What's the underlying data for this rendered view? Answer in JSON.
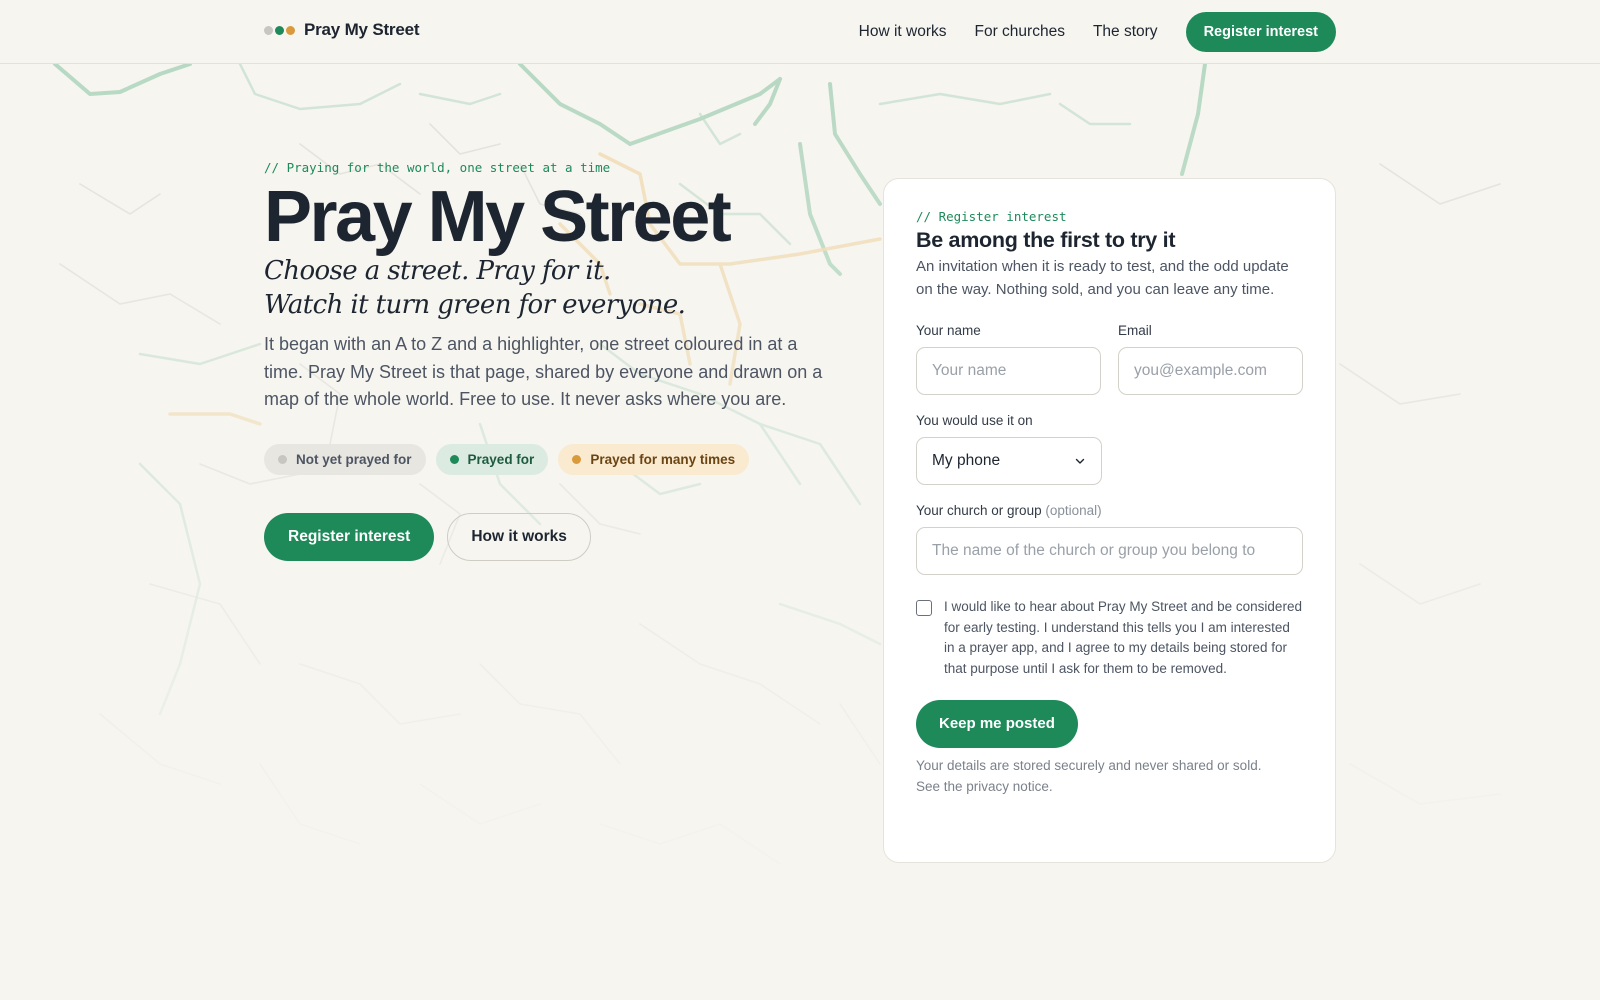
{
  "colors": {
    "accent": "#1e8a5a",
    "not_prayed": "#c8c6c0",
    "prayed": "#1e8a5a",
    "many_times": "#d99a3e"
  },
  "header": {
    "brand_name": "Pray My Street",
    "nav": [
      "How it works",
      "For churches",
      "The story"
    ],
    "cta_label": "Register interest"
  },
  "hero": {
    "eyebrow": "// Praying for the world, one street at a time",
    "title": "Pray My Street",
    "tagline_line1": "Choose a street. Pray for it.",
    "tagline_line2": "Watch it turn green for everyone.",
    "intro": "It began with an A to Z and a highlighter, one street coloured in at a time. Pray My Street is that page, shared by everyone and drawn on a map of the whole world. Free to use. It never asks where you are.",
    "legend": [
      {
        "label": "Not yet prayed for",
        "color": "#c8c6c0",
        "bg": "#e8e6e0",
        "text": "#4d5563"
      },
      {
        "label": "Prayed for",
        "color": "#1e8a5a",
        "bg": "#dcebe2",
        "text": "#1e5a3e"
      },
      {
        "label": "Prayed for many times",
        "color": "#d99a3e",
        "bg": "#f9ead0",
        "text": "#6b4414"
      }
    ],
    "primary_cta": "Register interest",
    "secondary_cta": "How it works"
  },
  "form": {
    "eyebrow": "// Register interest",
    "title": "Be among the first to try it",
    "lead": "An invitation when it is ready to test, and the odd update on the way. Nothing sold, and you can leave any time.",
    "name_label": "Your name",
    "name_placeholder": "Your name",
    "email_label": "Email",
    "email_placeholder": "you@example.com",
    "device_label": "You would use it on",
    "device_value": "My phone",
    "church_label": "Your church or group",
    "church_optional": "(optional)",
    "church_placeholder": "The name of the church or group you belong to",
    "consent": "I would like to hear about Pray My Street and be considered for early testing. I understand this tells you I am interested in a prayer app, and I agree to my details being stored for that purpose until I ask for them to be removed.",
    "submit": "Keep me posted",
    "fineprint": "Your details are stored securely and never shared or sold.",
    "privacy_link": "See the privacy notice."
  }
}
